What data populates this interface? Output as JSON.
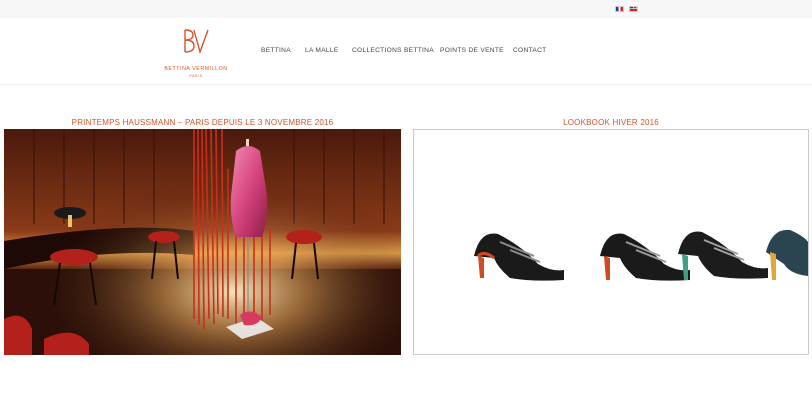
{
  "brand": {
    "name": "BETTINA VERMILLON",
    "city": "PARIS",
    "color": "#d1542b"
  },
  "languages": [
    {
      "code": "fr",
      "icon": "flag-france-icon"
    },
    {
      "code": "en",
      "icon": "flag-uk-icon"
    }
  ],
  "nav": {
    "items": [
      "BETTINA",
      "LA MALLE",
      "COLLECTIONS BETTINA",
      "POINTS DE VENTE",
      "CONTACT"
    ]
  },
  "features": [
    {
      "title": "PRINTEMPS HAUSSMANN – PARIS DEPUIS LE 3 NOVEMBRE 2016",
      "image": "store-display-photo"
    },
    {
      "title": "LOOKBOOK HIVER 2016",
      "image": "shoe-lookbook-photo"
    }
  ]
}
